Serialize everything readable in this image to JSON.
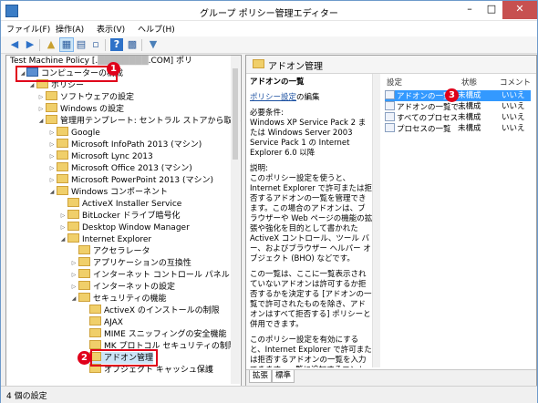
{
  "window": {
    "title": "グループ ポリシー管理エディター"
  },
  "menu": [
    "ファイル(F)",
    "操作(A)",
    "表示(V)",
    "ヘルプ(H)"
  ],
  "toolbar": {
    "icons": [
      "back-arrow-icon",
      "forward-arrow-icon",
      "up-folder-icon",
      "show-hide-tree-icon",
      "list-icon",
      "export-list-icon",
      "help-icon",
      "properties-icon",
      "filter-icon"
    ]
  },
  "tree": {
    "root": "Test Machine Policy [.",
    "root_suffix": ".COM] ポリ",
    "items": [
      {
        "label": "コンピューターの構成"
      },
      {
        "label": "ポリシー"
      },
      {
        "label": "ソフトウェアの設定"
      },
      {
        "label": "Windows の設定"
      },
      {
        "label": "管理用テンプレート: セントラル ストアから取得したポリシ"
      },
      {
        "label": "Google"
      },
      {
        "label": "Microsoft InfoPath 2013 (マシン)"
      },
      {
        "label": "Microsoft Lync 2013"
      },
      {
        "label": "Microsoft Office 2013 (マシン)"
      },
      {
        "label": "Microsoft PowerPoint 2013 (マシン)"
      },
      {
        "label": "Windows コンポーネント"
      },
      {
        "label": "ActiveX Installer Service"
      },
      {
        "label": "BitLocker ドライブ暗号化"
      },
      {
        "label": "Desktop Window Manager"
      },
      {
        "label": "Internet Explorer"
      },
      {
        "label": "アクセラレータ"
      },
      {
        "label": "アプリケーションの互換性"
      },
      {
        "label": "インターネット コントロール パネル"
      },
      {
        "label": "インターネットの設定"
      },
      {
        "label": "セキュリティの機能"
      },
      {
        "label": "ActiveX のインストールの制限"
      },
      {
        "label": "AJAX"
      },
      {
        "label": "MIME スニッフィングの安全機能"
      },
      {
        "label": "MK プロトコル セキュリティの制限"
      },
      {
        "label": "アドオン管理"
      },
      {
        "label": "オブジェクト キャッシュ保護"
      }
    ]
  },
  "badges": [
    "1",
    "2",
    "3"
  ],
  "right": {
    "header": "アドオン管理",
    "desc_title": "アドオンの一覧",
    "edit_link": "ポリシー設定",
    "edit_suffix": "の編集",
    "requirements": "必要条件:\nWindows XP Service Pack 2 または Windows Server 2003 Service Pack 1 の Internet Explorer 6.0 以降",
    "explanation": "説明:\nこのポリシー設定を使うと、Internet Explorer で許可または拒否するアドオンの一覧を管理できます。この場合のアドオンは、ブラウザーや Web ページの機能の拡張や強化を目的として書かれた ActiveX コントロール、ツール バー、およびブラウザー ヘルパー オブジェクト (BHO) などです。",
    "para3": "この一覧は、ここに一覧表示されていないアドオンは許可するか拒否するかを決定する [アドオンの一覧で許可されたものを除き、アドオンはすべて拒否する] ポリシーと併用できます。",
    "para4": "このポリシー設定を有効にすると、Internet Explorer で許可または拒否するアドオンの一覧を入力できます。一覧に追加するエントリそれぞれに対",
    "columns": {
      "setting": "設定",
      "state": "状態",
      "comment": "コメント"
    },
    "rows": [
      {
        "name": "アドオンの一覧",
        "state": "未構成",
        "comment": "いいえ"
      },
      {
        "name": "アドオンの一覧で...",
        "state": "未構成",
        "comment": "いいえ"
      },
      {
        "name": "すべてのプロセス",
        "state": "未構成",
        "comment": "いいえ"
      },
      {
        "name": "プロセスの一覧",
        "state": "未構成",
        "comment": "いいえ"
      }
    ],
    "tabs": [
      "拡張",
      "標準"
    ]
  },
  "status": "4 個の設定"
}
